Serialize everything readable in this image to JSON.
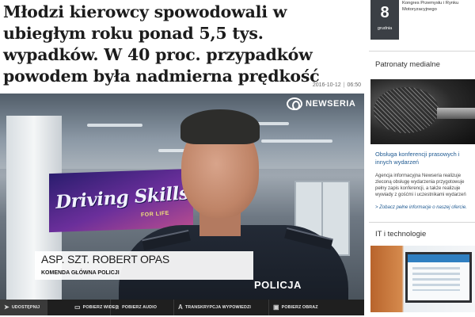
{
  "article": {
    "headline": "Młodzi kierowcy spowodowali w ubiegłym roku ponad 5,5 tys. wypadków. W 40 proc. przypadków powodem była nadmierna prędkość",
    "date": "2016-10-12",
    "time": "06:50"
  },
  "video": {
    "logo_text": "NEWSERIA",
    "lower_third_name": "ASP. SZT. ROBERT OPAS",
    "lower_third_org": "KOMENDA GŁÓWNA POLICJI",
    "background_banner": "Driving Skills",
    "background_banner_sub": "FOR LIFE",
    "uniform_text": "POLICJA"
  },
  "toolbar": {
    "share": "UDOSTĘPNIJ",
    "video": "POBIERZ WIDEO",
    "audio": "POBIERZ AUDIO",
    "transcript": "TRANSKRYPCJA WYPOWIEDZI",
    "image": "POBIERZ OBRAZ"
  },
  "sidebar": {
    "event_day": "8",
    "event_month": "grudnia",
    "event_title": "Kongres Przemysłu i Rynku Motoryzacyjnego",
    "patronage_heading": "Patronaty medialne",
    "promo_title": "Obsługa konferencji prasowych i innych wydarzeń",
    "promo_body": "Agencja informacyjna Newseria realizuje zleconą obsługę wydarzenia przygotowuje pełny zapis konferencji, a także realizuje wywiady z gośćmi i uczestnikami wydarzeń",
    "promo_more": "Zobacz pełne informacje o naszej ofercie.",
    "section_heading": "IT i technologie"
  },
  "colors": {
    "toolbar_bg": "#1f1f1f",
    "date_box_bg": "#3b3f45",
    "link": "#1f5a92"
  },
  "icons": {
    "share": "share-icon",
    "video": "monitor-icon",
    "audio": "music-note-icon",
    "transcript": "text-icon",
    "image": "image-icon"
  }
}
